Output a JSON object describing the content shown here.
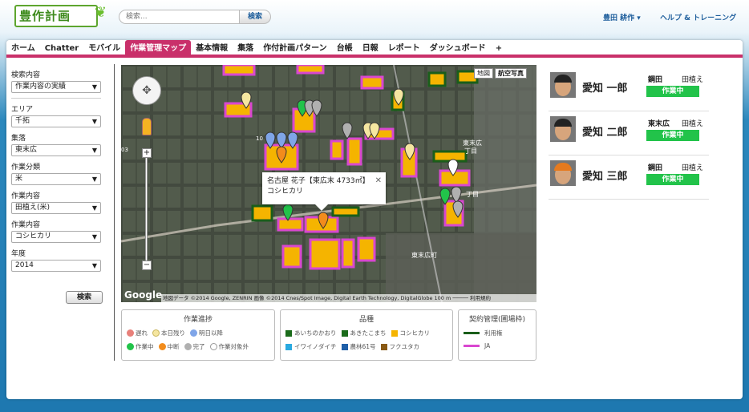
{
  "header": {
    "logo": "豊作計画",
    "search_placeholder": "検索...",
    "search_button": "検索",
    "user_menu": "豊田 耕作 ▾",
    "help_link": "ヘルプ & トレーニング"
  },
  "tabs": [
    "ホーム",
    "Chatter",
    "モバイル",
    "作業管理マップ",
    "基本情報",
    "集落",
    "作付計画パターン",
    "台帳",
    "日報",
    "レポート",
    "ダッシュボード",
    "+"
  ],
  "active_tab": 3,
  "sidebar": {
    "search_label": "検索内容",
    "search_value": "作業内容の実績",
    "fields": [
      {
        "label": "エリア",
        "value": "千拓"
      },
      {
        "label": "集落",
        "value": "東末広"
      },
      {
        "label": "作業分類",
        "value": "米"
      },
      {
        "label": "作業内容",
        "value": "田植え(米)"
      },
      {
        "label": "作業内容",
        "value": "コシヒカリ"
      },
      {
        "label": "年度",
        "value": "2014"
      }
    ],
    "search_button": "検索"
  },
  "map": {
    "type_map": "地図",
    "type_satellite": "航空写真",
    "google": "Google",
    "attribution": "地図データ ©2014 Google, ZENRIN 画像 ©2014 Cnes/Spot Image, Digital Earth Technology, DigitalGlobe   100 m ─────   利用規約",
    "info_title": "名古屋 花子【東広末 4733㎡】",
    "info_sub": "コシヒカリ",
    "label_town1": "東末広",
    "label_town1b": "丁目",
    "label_town2": "東末広町",
    "label_town3": "丁目",
    "label_10": "10",
    "label_03": "03"
  },
  "legend_progress": {
    "title": "作業進捗",
    "row1": [
      {
        "label": "遅れ",
        "color": "#e8807a"
      },
      {
        "label": "本日残り",
        "color": "#f5e6a0"
      },
      {
        "label": "明日以降",
        "color": "#7fa5e8"
      }
    ],
    "row2": [
      {
        "label": "作業中",
        "color": "#22c34a"
      },
      {
        "label": "中断",
        "color": "#f28c1c"
      },
      {
        "label": "完了",
        "color": "#b0b0b0"
      },
      {
        "label": "作業対象外",
        "color": "#ffffff"
      }
    ]
  },
  "legend_variety": {
    "title": "品種",
    "row1": [
      {
        "label": "あいちのかおり",
        "color": "#1a6b1a"
      },
      {
        "label": "あきたこまち",
        "color": "#1a6b1a"
      },
      {
        "label": "コシヒカリ",
        "color": "#f5b400"
      }
    ],
    "row2": [
      {
        "label": "イワイノダイチ",
        "color": "#29a9e0"
      },
      {
        "label": "農林61号",
        "color": "#1f5fa8"
      },
      {
        "label": "フクユタカ",
        "color": "#8a5a14"
      }
    ]
  },
  "legend_contract": {
    "title": "契約管理(圃場枠)",
    "items": [
      {
        "label": "利用権",
        "color": "#1a5e1a"
      },
      {
        "label": "JA",
        "color": "#d947d0"
      }
    ]
  },
  "workers": [
    {
      "name": "愛知 一郎",
      "location": "鋼田",
      "task": "田植え",
      "status": "作業中"
    },
    {
      "name": "愛知 二郎",
      "location": "東末広",
      "task": "田植え",
      "status": "作業中"
    },
    {
      "name": "愛知 三郎",
      "location": "鋼田",
      "task": "田植え",
      "status": "作業中"
    }
  ]
}
